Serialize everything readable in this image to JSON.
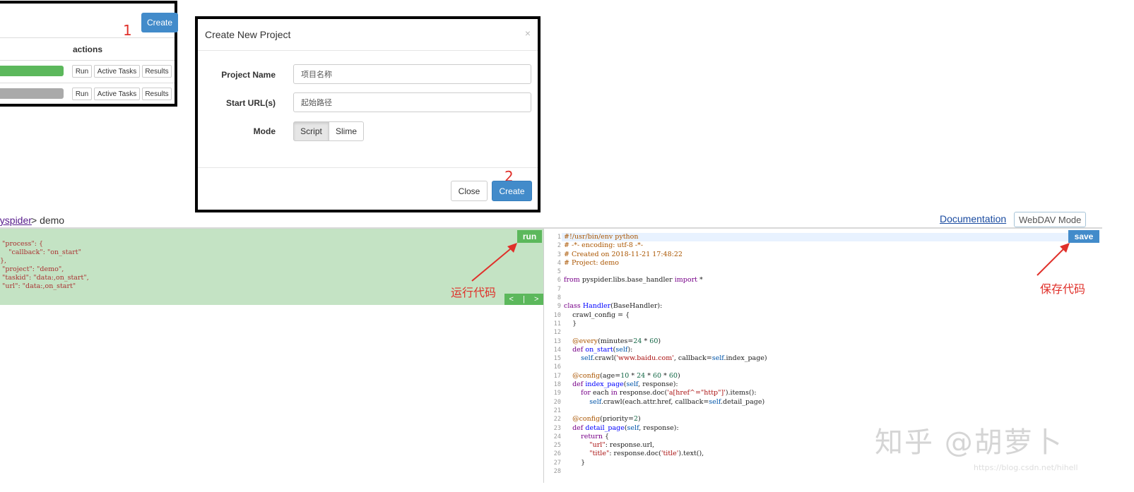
{
  "project_list": {
    "create_button": "Create",
    "step_marker": "1",
    "actions_header": "actions",
    "rows": [
      {
        "progress_color": "#5cb85c",
        "run": "Run",
        "active_tasks": "Active Tasks",
        "results": "Results"
      },
      {
        "progress_color": "#aaaaaa",
        "run": "Run",
        "active_tasks": "Active Tasks",
        "results": "Results"
      }
    ]
  },
  "modal": {
    "title": "Create New Project",
    "close_icon": "×",
    "project_name_label": "Project Name",
    "project_name_value": "项目名称",
    "start_url_label": "Start URL(s)",
    "start_url_value": "起始路径",
    "mode_label": "Mode",
    "mode_options": [
      "Script",
      "Slime"
    ],
    "mode_selected": "Script",
    "close_button": "Close",
    "create_button": "Create",
    "step_marker": "2"
  },
  "editor": {
    "breadcrumb_root": "pyspider",
    "breadcrumb_rest": " > demo",
    "documentation_link": "Documentation",
    "webdav_button": "WebDAV Mode",
    "run_button": "run",
    "save_button": "save",
    "pager_prev": "<",
    "pager_sep": "|",
    "pager_next": ">",
    "run_annotation": "运行代码",
    "save_annotation": "保存代码",
    "left_code_lines": [
      " \"process\": {",
      "    \"callback\": \"on_start\"",
      "},",
      " \"project\": \"demo\",",
      " \"taskid\": \"data:,on_start\",",
      " \"url\": \"data:,on_start\""
    ],
    "line_numbers": [
      "1",
      "2",
      "3",
      "4",
      "5",
      "6",
      "7",
      "8",
      "9",
      "10",
      "11",
      "12",
      "13",
      "14",
      "15",
      "16",
      "17",
      "18",
      "19",
      "20",
      "21",
      "22",
      "23",
      "24",
      "25",
      "26",
      "27",
      "28"
    ]
  },
  "watermark": {
    "zhihu": "知乎 @胡萝卜",
    "csdn": "https://blog.csdn.net/hihell"
  },
  "colors": {
    "accent_blue": "#428bca",
    "success_green": "#5cb85c",
    "annotation_red": "#e0302a",
    "panel_green": "#c4e3c4"
  }
}
